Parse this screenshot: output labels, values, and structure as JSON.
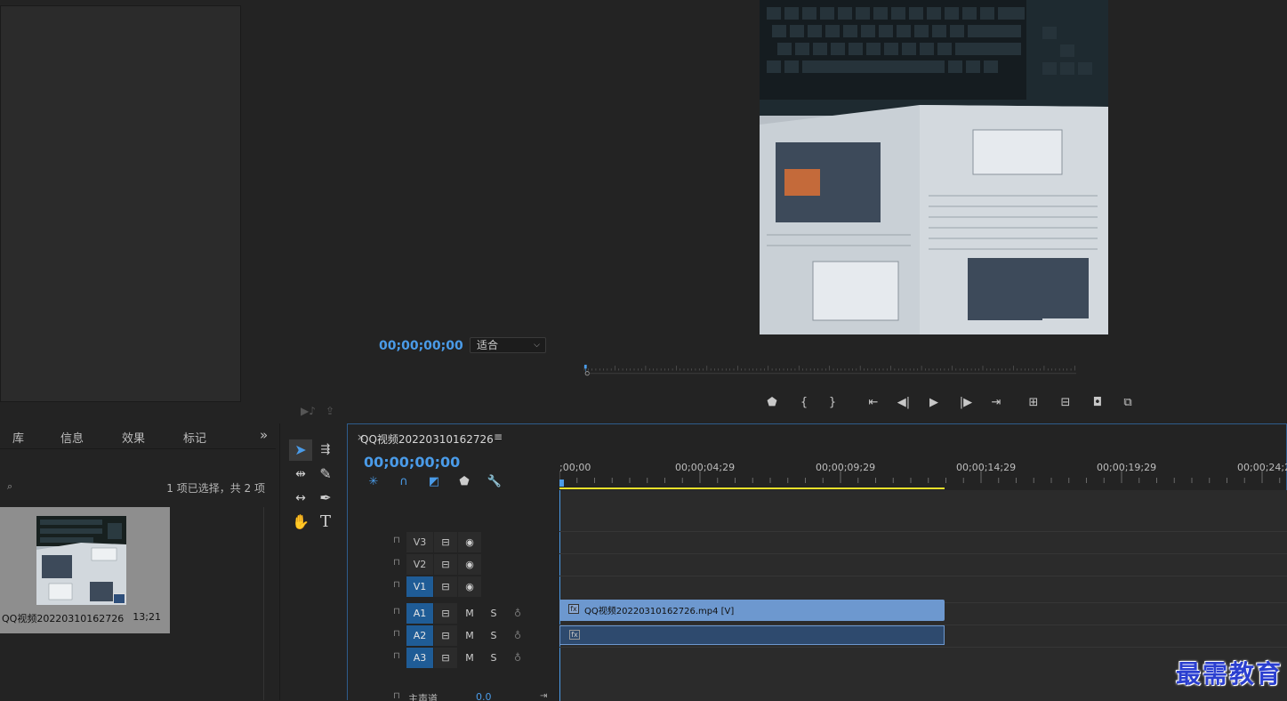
{
  "program_monitor": {
    "timecode": "00;00;00;00",
    "fit_label": "适合"
  },
  "project_panel": {
    "tabs": [
      "库",
      "信息",
      "效果",
      "标记"
    ],
    "more_glyph": "»",
    "selection_count": "1 项已选择，共 2 项",
    "item": {
      "name": "QQ视频20220310162726",
      "duration": "13;21"
    }
  },
  "timeline": {
    "sequence_tab": "QQ视频20220310162726",
    "timecode": "00;00;00;00",
    "ruler_labels": [
      ";00;00",
      "00;00;04;29",
      "00;00;09;29",
      "00;00;14;29",
      "00;00;19;29",
      "00;00;24;29"
    ],
    "tracks": [
      {
        "name": "V3",
        "targeted": false,
        "type": "video"
      },
      {
        "name": "V2",
        "targeted": false,
        "type": "video"
      },
      {
        "name": "V1",
        "targeted": true,
        "type": "video"
      },
      {
        "name": "A1",
        "targeted": true,
        "type": "audio"
      },
      {
        "name": "A2",
        "targeted": true,
        "type": "audio"
      },
      {
        "name": "A3",
        "targeted": true,
        "type": "audio"
      }
    ],
    "audio_mute": "M",
    "audio_solo": "S",
    "master_label": "主声道",
    "master_value": "0.0",
    "video_clip_label": "QQ视频20220310162726.mp4 [V]"
  },
  "colors": {
    "accent_blue": "#4a9be8",
    "work_area_yellow": "#e8e02a",
    "clip_video": "#6d98cf",
    "track_target": "#1f5c96"
  },
  "watermark": "最需教育"
}
